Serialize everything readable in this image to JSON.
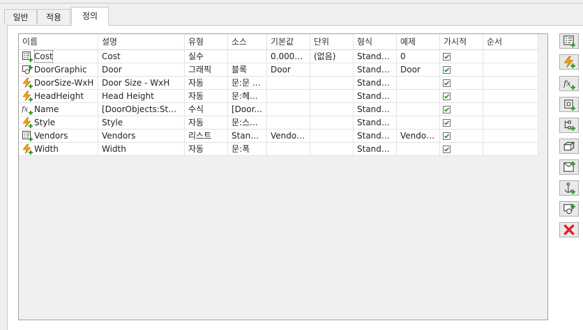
{
  "tabs": [
    {
      "label": "일반",
      "active": false
    },
    {
      "label": "적용",
      "active": false
    },
    {
      "label": "정의",
      "active": true
    }
  ],
  "columns": [
    "이름",
    "설명",
    "유형",
    "소스",
    "기본값",
    "단위",
    "형식",
    "예제",
    "가시적",
    "순서"
  ],
  "rows": [
    {
      "icon": "list-icon",
      "name": "Cost",
      "description": "Cost",
      "type": "실수",
      "source": "",
      "default": "0.0000...",
      "unit": "(없음)",
      "format": "Standard",
      "example": "0",
      "visible": true,
      "order": ""
    },
    {
      "icon": "graphic-icon",
      "name": "DoorGraphic",
      "description": "Door",
      "type": "그래픽",
      "source": "블록",
      "default": "Door",
      "unit": "",
      "format": "Standard",
      "example": "Door",
      "visible": true,
      "order": ""
    },
    {
      "icon": "auto-icon",
      "name": "DoorSize-WxH",
      "description": "Door Size - WxH",
      "type": "자동",
      "source": "문:문 ...",
      "default": "",
      "unit": "",
      "format": "Standard",
      "example": "",
      "visible": true,
      "order": ""
    },
    {
      "icon": "auto-icon",
      "name": "HeadHeight",
      "description": "Head Height",
      "type": "자동",
      "source": "문:헤...",
      "default": "",
      "unit": "",
      "format": "Standard",
      "example": "",
      "visible": true,
      "order": ""
    },
    {
      "icon": "formula-icon",
      "name": "Name",
      "description": "[DoorObjects:Style]",
      "type": "수식",
      "source": "[Door...",
      "default": "",
      "unit": "",
      "format": "Standard",
      "example": "",
      "visible": true,
      "order": ""
    },
    {
      "icon": "auto-icon",
      "name": "Style",
      "description": "Style",
      "type": "자동",
      "source": "문:스...",
      "default": "",
      "unit": "",
      "format": "Standard",
      "example": "",
      "visible": true,
      "order": ""
    },
    {
      "icon": "list-icon",
      "name": "Vendors",
      "description": "Vendors",
      "type": "리스트",
      "source": "Stand...",
      "default": "Vendor...",
      "unit": "",
      "format": "Standard",
      "example": "Vendor...",
      "visible": true,
      "order": ""
    },
    {
      "icon": "auto-icon",
      "name": "Width",
      "description": "Width",
      "type": "자동",
      "source": "문:폭",
      "default": "",
      "unit": "",
      "format": "Standard",
      "example": "",
      "visible": true,
      "order": ""
    }
  ],
  "side_buttons": [
    "add-list-property-icon",
    "add-auto-property-icon",
    "add-formula-property-icon",
    "add-location-property-icon",
    "add-classification-property-icon",
    "add-material-property-icon",
    "add-graphic-block-property-icon",
    "add-anchor-property-icon",
    "add-graphic-property-icon",
    "delete-icon"
  ],
  "colors": {
    "accent_green": "#2e9a2e",
    "auto_orange": "#f0a01e",
    "delete_red": "#e02020",
    "checkbox_green": "#1a8a1a"
  }
}
